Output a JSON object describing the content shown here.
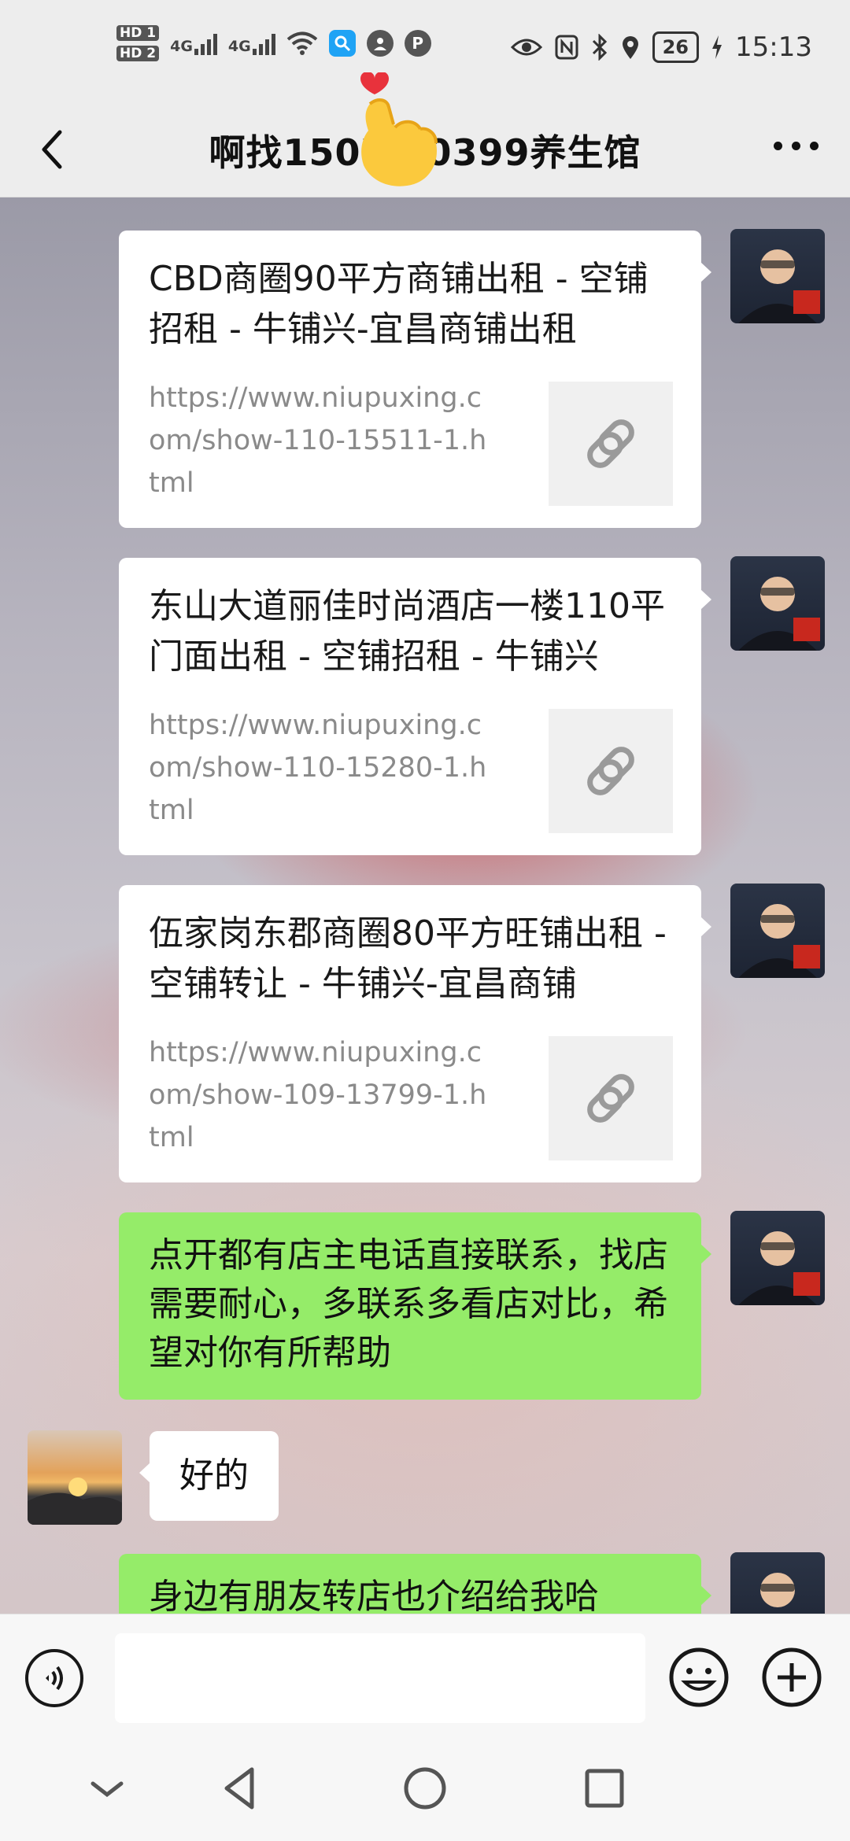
{
  "status_bar": {
    "hd1": "HD 1",
    "hd2": "HD 2",
    "net1": "4G",
    "net2": "4G",
    "battery": "26",
    "time": "15:13"
  },
  "header": {
    "title": "啊找1507  10399养生馆"
  },
  "messages": [
    {
      "title": "CBD商圈90平方商铺出租 - 空铺招租 - 牛铺兴-宜昌商铺出租",
      "url": "https://www.niupuxing.com/show-110-15511-1.html"
    },
    {
      "title": "东山大道丽佳时尚酒店一楼110平门面出租 - 空铺招租 - 牛铺兴",
      "url": "https://www.niupuxing.com/show-110-15280-1.html"
    },
    {
      "title": "伍家岗东郡商圈80平方旺铺出租 - 空铺转让 - 牛铺兴-宜昌商铺",
      "url": "https://www.niupuxing.com/show-109-13799-1.html"
    }
  ],
  "text_messages": {
    "green_1": "点开都有店主电话直接联系，找店需要耐心，多联系多看店对比，希望对你有所帮助",
    "reply": "好的",
    "green_2": "身边有朋友转店也介绍给我哈"
  },
  "input": {
    "placeholder": ""
  },
  "colors": {
    "green_bubble": "#95ec69",
    "background": "#ededed"
  }
}
